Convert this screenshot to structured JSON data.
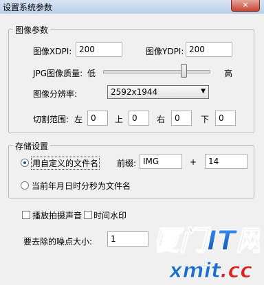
{
  "window": {
    "title": "设置系统参数"
  },
  "image_params": {
    "legend": "图像参数",
    "xdpi_label": "图像XDPI:",
    "xdpi_value": "200",
    "ydpi_label": "图像YDPI:",
    "ydpi_value": "200",
    "quality_label": "JPG图像质量:",
    "quality_low": "低",
    "quality_high": "高",
    "quality_level": 0.78,
    "resolution_label": "图像分辨率:",
    "resolution_value": "2592x1944",
    "crop_label": "切割范围:",
    "crop_left_label": "左",
    "crop_left_value": "0",
    "crop_top_label": "上",
    "crop_top_value": "0",
    "crop_right_label": "右",
    "crop_right_value": "0",
    "crop_bottom_label": "下",
    "crop_bottom_value": "0"
  },
  "storage": {
    "legend": "存储设置",
    "custom_name_label": "用自定义的文件名",
    "custom_name_checked": true,
    "prefix_label": "前缀:",
    "prefix_value": "IMG",
    "plus_label": "+",
    "suffix_value": "14",
    "datetime_name_label": "当前年月日时分秒为文件名",
    "datetime_name_checked": false
  },
  "options": {
    "play_sound_label": "播放拍摄声音",
    "play_sound_checked": false,
    "time_watermark_label": "时间水印",
    "time_watermark_checked": false,
    "noise_label": "要去除的噪点大小:",
    "noise_value": "1"
  },
  "watermark": {
    "brand_cn": "厦门IT网",
    "brand_url": "xmit.cc",
    "colors": {
      "cn": "#1a6fd1",
      "url_blue": "#1a6fd1",
      "url_red": "#e02222"
    }
  },
  "colors": {
    "radio_dot": "#1e5aa8",
    "close_button": "#c64633"
  }
}
